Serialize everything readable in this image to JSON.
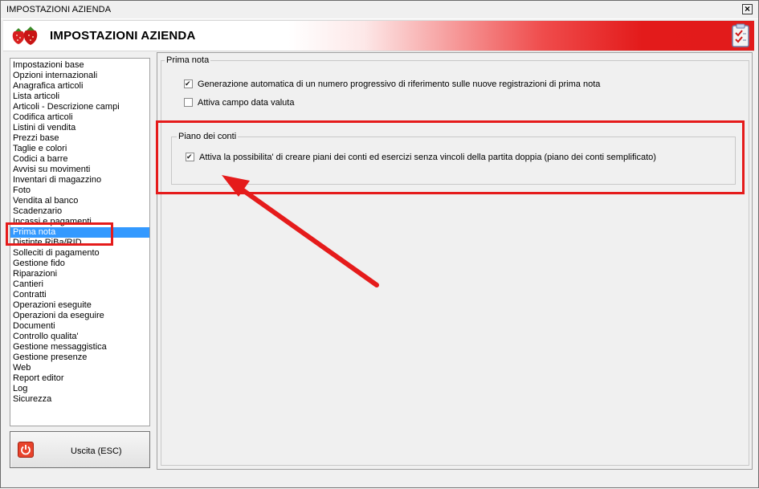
{
  "window": {
    "title": "IMPOSTAZIONI AZIENDA",
    "close_glyph": "×"
  },
  "banner": {
    "title": "IMPOSTAZIONI AZIENDA",
    "logo_icon": "strawberry-icon",
    "right_icon": "checklist-icon"
  },
  "nav": {
    "items": [
      "Impostazioni base",
      "Opzioni internazionali",
      "Anagrafica articoli",
      "Lista articoli",
      "Articoli - Descrizione campi",
      "Codifica articoli",
      "Listini di vendita",
      "Prezzi base",
      "Taglie e colori",
      "Codici a barre",
      "Avvisi su movimenti",
      "Inventari di magazzino",
      "Foto",
      "Vendita al banco",
      "Scadenzario",
      "Incassi e pagamenti",
      "Prima nota",
      "Distinte RiBa/RID",
      "Solleciti di pagamento",
      "Gestione fido",
      "Riparazioni",
      "Cantieri",
      "Contratti",
      "Operazioni eseguite",
      "Operazioni da eseguire",
      "Documenti",
      "Controllo qualita'",
      "Gestione messaggistica",
      "Gestione presenze",
      "Web",
      "Report editor",
      "Log",
      "Sicurezza"
    ],
    "selected_index": 16
  },
  "exit_button": {
    "label": "Uscita (ESC)",
    "icon": "power-icon"
  },
  "prima_nota_group": {
    "legend": "Prima nota",
    "options": [
      {
        "label": "Generazione automatica di un numero progressivo di riferimento sulle nuove registrazioni di prima nota",
        "checked": true
      },
      {
        "label": "Attiva campo data valuta",
        "checked": false
      }
    ]
  },
  "piano_group": {
    "legend": "Piano dei conti",
    "options": [
      {
        "label": "Attiva la possibilita' di creare piani dei conti ed esercizi senza vincoli della partita doppia (piano dei conti semplificato)",
        "checked": true
      }
    ]
  },
  "annotation": {
    "color": "#e51b1b"
  }
}
